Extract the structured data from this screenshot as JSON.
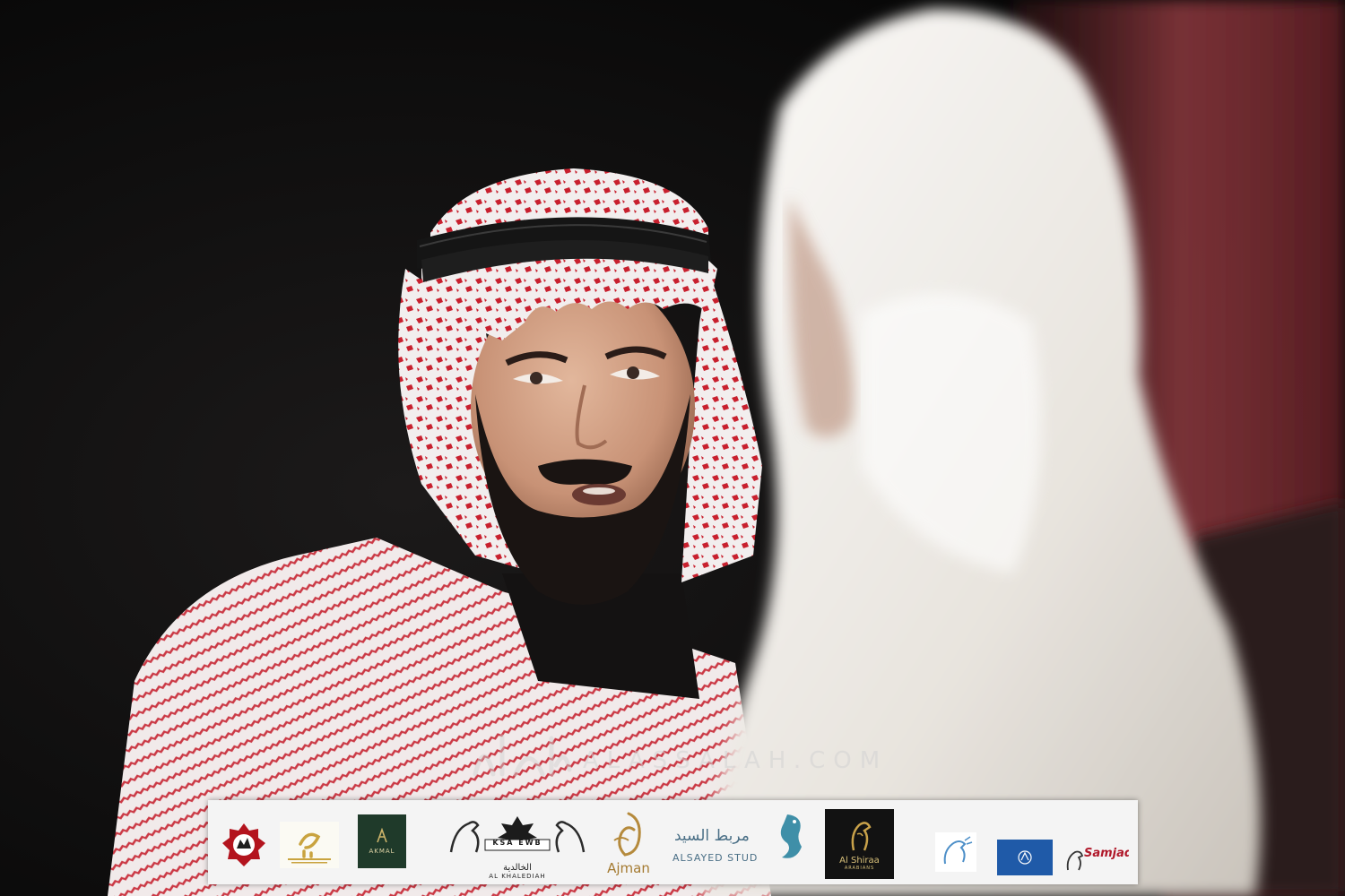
{
  "photo": {
    "description_icon": "photo-scene",
    "colors": {
      "background": "#0d0d0d",
      "shemagh_red": "#c8202e",
      "shemagh_white": "#f2eeee",
      "thobe_white": "#f3f1ee"
    }
  },
  "watermark": {
    "text": "ALASSALAH.COM"
  },
  "sponsors": {
    "akmal": "AKMAL",
    "khalediah_badge": "KSA EWB",
    "khalediah": "AL KHALEDIAH",
    "ajman": "Ajman",
    "alsayed_ar": "مربط السيد",
    "alsayed": "ALSAYED STUD",
    "alshiraa_1": "Al Shiraa",
    "alshiraa_2": "ARABIANS",
    "alkhalidiya": "الخالدية",
    "samjad": "Samjad"
  }
}
